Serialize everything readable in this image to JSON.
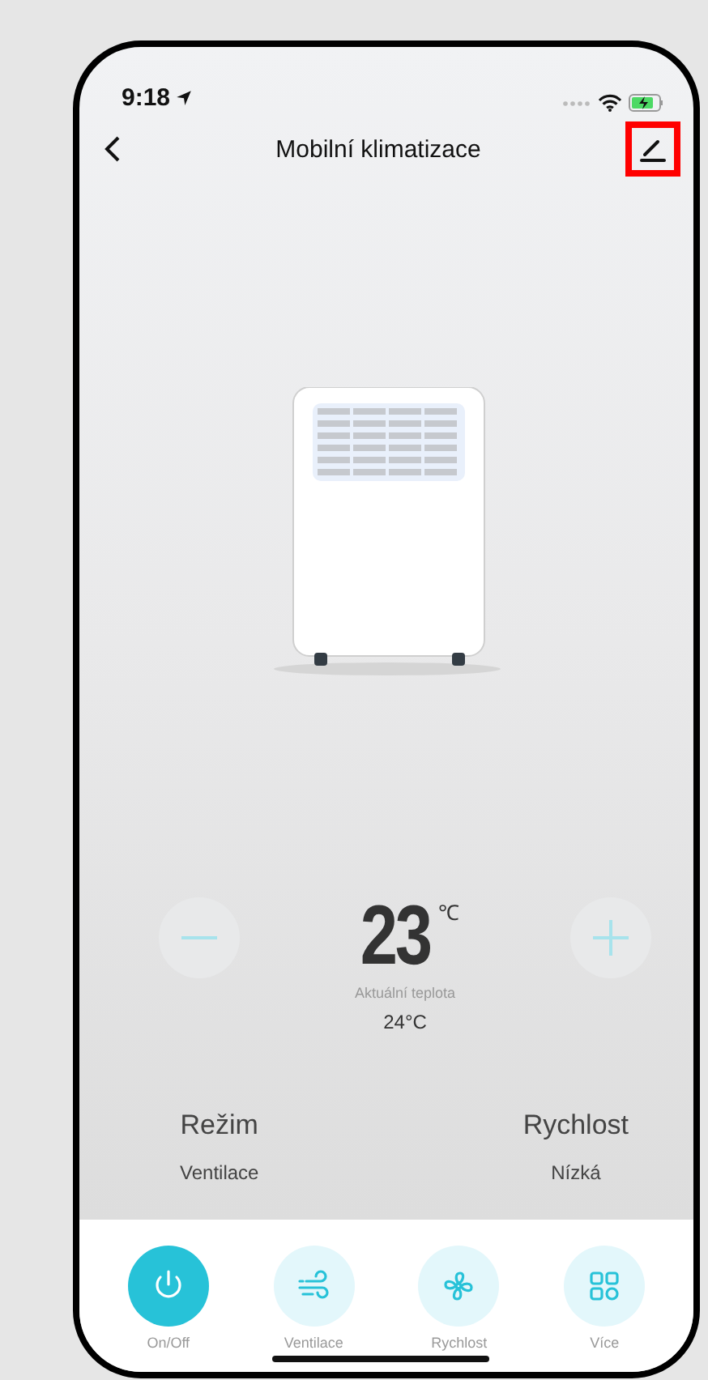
{
  "status_bar": {
    "time": "9:18"
  },
  "header": {
    "title": "Mobilní klimatizace",
    "edit_highlighted": true
  },
  "temperature": {
    "value": "23",
    "unit": "℃",
    "caption": "Aktuální teplota",
    "current": "24°C"
  },
  "settings": [
    {
      "label": "Režim",
      "value": "Ventilace"
    },
    {
      "label": "Rychlost",
      "value": "Nízká"
    }
  ],
  "bottom_bar": [
    {
      "kind": "power",
      "label": "On/Off",
      "selected": true
    },
    {
      "kind": "wind",
      "label": "Ventilace",
      "selected": false
    },
    {
      "kind": "fan",
      "label": "Rychlost",
      "selected": false
    },
    {
      "kind": "grid",
      "label": "Více",
      "selected": false
    }
  ]
}
